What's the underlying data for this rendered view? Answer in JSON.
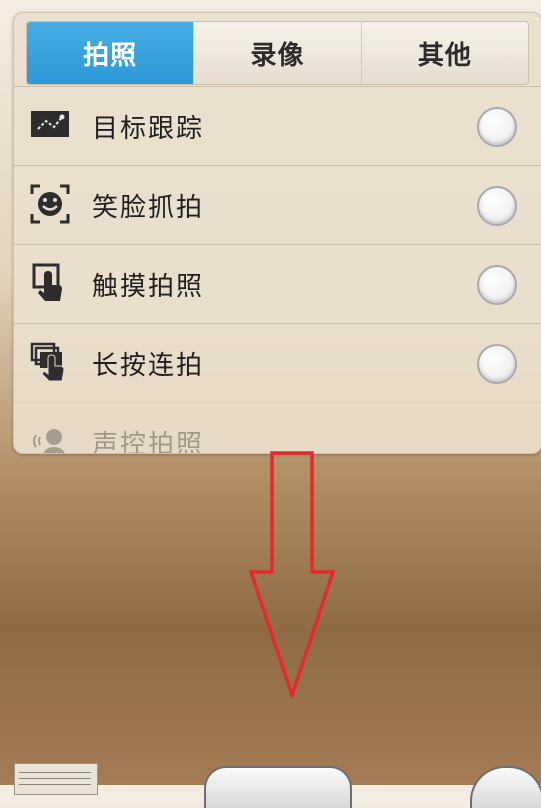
{
  "tabs": {
    "photo": "拍照",
    "video": "录像",
    "other": "其他"
  },
  "settings": [
    {
      "label": "目标跟踪",
      "icon": "target-tracking-icon",
      "enabled": false
    },
    {
      "label": "笑脸抓拍",
      "icon": "smile-capture-icon",
      "enabled": false
    },
    {
      "label": "触摸拍照",
      "icon": "touch-shoot-icon",
      "enabled": false
    },
    {
      "label": "长按连拍",
      "icon": "burst-shoot-icon",
      "enabled": false
    },
    {
      "label": "声控拍照",
      "icon": "voice-control-icon",
      "enabled": false
    }
  ],
  "colors": {
    "active_tab": "#3aa6e0",
    "annotation_arrow": "#e8282b"
  }
}
